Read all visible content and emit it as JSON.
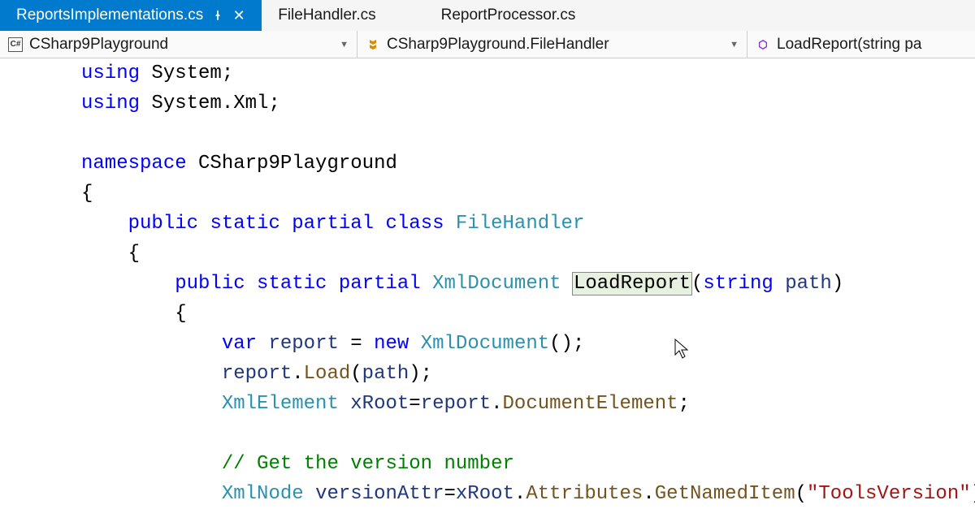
{
  "tabs": [
    {
      "label": "ReportsImplementations.cs",
      "active": true,
      "pinned": true
    },
    {
      "label": "FileHandler.cs",
      "active": false
    },
    {
      "label": "ReportProcessor.cs",
      "active": false
    }
  ],
  "breadcrumbs": [
    {
      "icon": "csharp",
      "label": "CSharp9Playground"
    },
    {
      "icon": "class",
      "label": "CSharp9Playground.FileHandler"
    },
    {
      "icon": "method",
      "label": "LoadReport(string pa"
    }
  ],
  "code": {
    "l1_kw1": "using",
    "l1_ns": "System",
    "l2_kw1": "using",
    "l2_ns": "System.Xml",
    "l4_kw": "namespace",
    "l4_ns": "CSharp9Playground",
    "l6_kw1": "public",
    "l6_kw2": "static",
    "l6_kw3": "partial",
    "l6_kw4": "class",
    "l6_type": "FileHandler",
    "l8_kw1": "public",
    "l8_kw2": "static",
    "l8_kw3": "partial",
    "l8_type": "XmlDocument",
    "l8_name": "LoadReport",
    "l8_p_kw": "string",
    "l8_p_id": "path",
    "l10_kw": "var",
    "l10_id": "report",
    "l10_kw2": "new",
    "l10_type": "XmlDocument",
    "l11_id": "report",
    "l11_m": "Load",
    "l11_arg": "path",
    "l12_type": "XmlElement",
    "l12_id": "xRoot",
    "l12_id2": "report",
    "l12_prop": "DocumentElement",
    "l14_com": "// Get the version number",
    "l15_type": "XmlNode",
    "l15_id": "versionAttr",
    "l15_id2": "xRoot",
    "l15_prop": "Attributes",
    "l15_m": "GetNamedItem",
    "l15_str": "\"ToolsVersion\""
  }
}
